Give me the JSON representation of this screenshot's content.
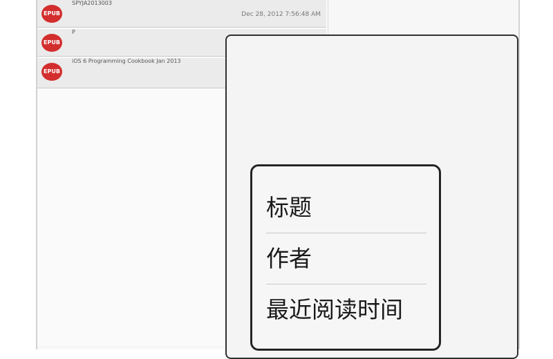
{
  "book_list": {
    "items": [
      {
        "title": "SPYJA2013003",
        "date": "Dec 28, 2012 7:56:48 AM",
        "logo": "EPUB"
      },
      {
        "title": "P",
        "date": "",
        "logo": "EPUB"
      },
      {
        "title": "iOS 6 Programming Cookbook Jan 2013",
        "date": "",
        "logo": "EPUB"
      }
    ]
  },
  "sort_menu": {
    "options": [
      "标题",
      "作者",
      "最近阅读时间"
    ]
  }
}
